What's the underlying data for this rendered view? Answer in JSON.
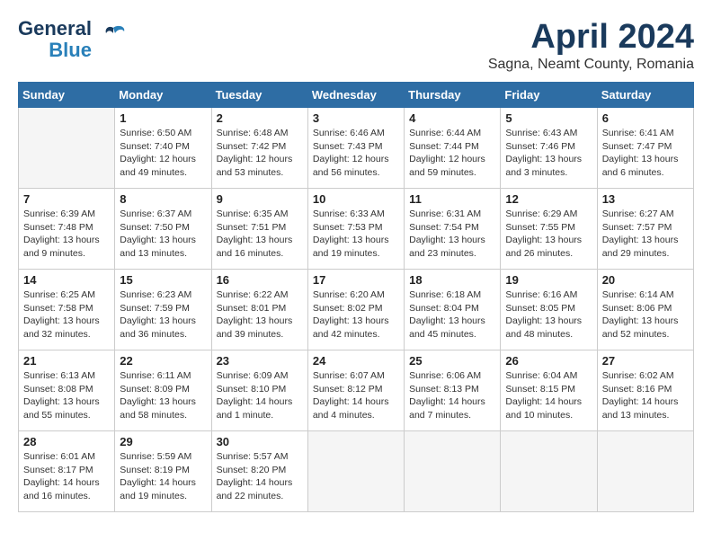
{
  "header": {
    "logo_line1": "General",
    "logo_line2": "Blue",
    "month_year": "April 2024",
    "location": "Sagna, Neamt County, Romania"
  },
  "days_of_week": [
    "Sunday",
    "Monday",
    "Tuesday",
    "Wednesday",
    "Thursday",
    "Friday",
    "Saturday"
  ],
  "weeks": [
    [
      {
        "day": "",
        "info": ""
      },
      {
        "day": "1",
        "info": "Sunrise: 6:50 AM\nSunset: 7:40 PM\nDaylight: 12 hours\nand 49 minutes."
      },
      {
        "day": "2",
        "info": "Sunrise: 6:48 AM\nSunset: 7:42 PM\nDaylight: 12 hours\nand 53 minutes."
      },
      {
        "day": "3",
        "info": "Sunrise: 6:46 AM\nSunset: 7:43 PM\nDaylight: 12 hours\nand 56 minutes."
      },
      {
        "day": "4",
        "info": "Sunrise: 6:44 AM\nSunset: 7:44 PM\nDaylight: 12 hours\nand 59 minutes."
      },
      {
        "day": "5",
        "info": "Sunrise: 6:43 AM\nSunset: 7:46 PM\nDaylight: 13 hours\nand 3 minutes."
      },
      {
        "day": "6",
        "info": "Sunrise: 6:41 AM\nSunset: 7:47 PM\nDaylight: 13 hours\nand 6 minutes."
      }
    ],
    [
      {
        "day": "7",
        "info": "Sunrise: 6:39 AM\nSunset: 7:48 PM\nDaylight: 13 hours\nand 9 minutes."
      },
      {
        "day": "8",
        "info": "Sunrise: 6:37 AM\nSunset: 7:50 PM\nDaylight: 13 hours\nand 13 minutes."
      },
      {
        "day": "9",
        "info": "Sunrise: 6:35 AM\nSunset: 7:51 PM\nDaylight: 13 hours\nand 16 minutes."
      },
      {
        "day": "10",
        "info": "Sunrise: 6:33 AM\nSunset: 7:53 PM\nDaylight: 13 hours\nand 19 minutes."
      },
      {
        "day": "11",
        "info": "Sunrise: 6:31 AM\nSunset: 7:54 PM\nDaylight: 13 hours\nand 23 minutes."
      },
      {
        "day": "12",
        "info": "Sunrise: 6:29 AM\nSunset: 7:55 PM\nDaylight: 13 hours\nand 26 minutes."
      },
      {
        "day": "13",
        "info": "Sunrise: 6:27 AM\nSunset: 7:57 PM\nDaylight: 13 hours\nand 29 minutes."
      }
    ],
    [
      {
        "day": "14",
        "info": "Sunrise: 6:25 AM\nSunset: 7:58 PM\nDaylight: 13 hours\nand 32 minutes."
      },
      {
        "day": "15",
        "info": "Sunrise: 6:23 AM\nSunset: 7:59 PM\nDaylight: 13 hours\nand 36 minutes."
      },
      {
        "day": "16",
        "info": "Sunrise: 6:22 AM\nSunset: 8:01 PM\nDaylight: 13 hours\nand 39 minutes."
      },
      {
        "day": "17",
        "info": "Sunrise: 6:20 AM\nSunset: 8:02 PM\nDaylight: 13 hours\nand 42 minutes."
      },
      {
        "day": "18",
        "info": "Sunrise: 6:18 AM\nSunset: 8:04 PM\nDaylight: 13 hours\nand 45 minutes."
      },
      {
        "day": "19",
        "info": "Sunrise: 6:16 AM\nSunset: 8:05 PM\nDaylight: 13 hours\nand 48 minutes."
      },
      {
        "day": "20",
        "info": "Sunrise: 6:14 AM\nSunset: 8:06 PM\nDaylight: 13 hours\nand 52 minutes."
      }
    ],
    [
      {
        "day": "21",
        "info": "Sunrise: 6:13 AM\nSunset: 8:08 PM\nDaylight: 13 hours\nand 55 minutes."
      },
      {
        "day": "22",
        "info": "Sunrise: 6:11 AM\nSunset: 8:09 PM\nDaylight: 13 hours\nand 58 minutes."
      },
      {
        "day": "23",
        "info": "Sunrise: 6:09 AM\nSunset: 8:10 PM\nDaylight: 14 hours\nand 1 minute."
      },
      {
        "day": "24",
        "info": "Sunrise: 6:07 AM\nSunset: 8:12 PM\nDaylight: 14 hours\nand 4 minutes."
      },
      {
        "day": "25",
        "info": "Sunrise: 6:06 AM\nSunset: 8:13 PM\nDaylight: 14 hours\nand 7 minutes."
      },
      {
        "day": "26",
        "info": "Sunrise: 6:04 AM\nSunset: 8:15 PM\nDaylight: 14 hours\nand 10 minutes."
      },
      {
        "day": "27",
        "info": "Sunrise: 6:02 AM\nSunset: 8:16 PM\nDaylight: 14 hours\nand 13 minutes."
      }
    ],
    [
      {
        "day": "28",
        "info": "Sunrise: 6:01 AM\nSunset: 8:17 PM\nDaylight: 14 hours\nand 16 minutes."
      },
      {
        "day": "29",
        "info": "Sunrise: 5:59 AM\nSunset: 8:19 PM\nDaylight: 14 hours\nand 19 minutes."
      },
      {
        "day": "30",
        "info": "Sunrise: 5:57 AM\nSunset: 8:20 PM\nDaylight: 14 hours\nand 22 minutes."
      },
      {
        "day": "",
        "info": ""
      },
      {
        "day": "",
        "info": ""
      },
      {
        "day": "",
        "info": ""
      },
      {
        "day": "",
        "info": ""
      }
    ]
  ]
}
